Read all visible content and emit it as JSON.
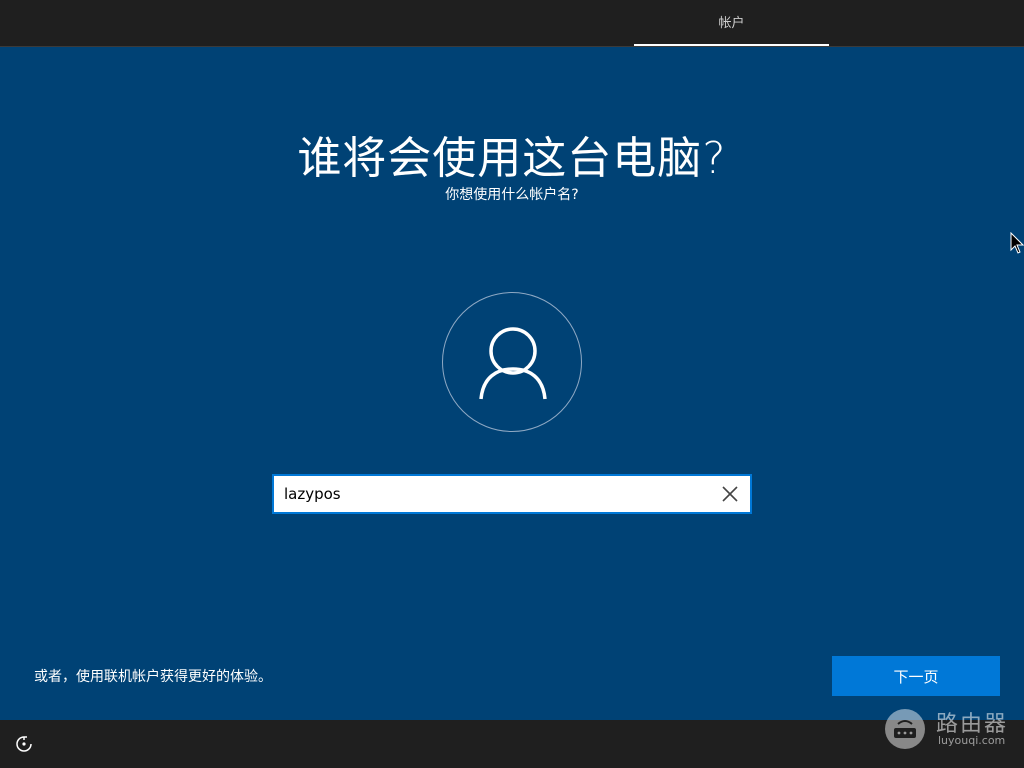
{
  "topbar": {
    "tab_label": "帐户"
  },
  "main": {
    "title": "谁将会使用这台电脑?",
    "subtitle": "你想使用什么帐户名?",
    "avatar_icon": "user-icon"
  },
  "name_input": {
    "value": "lazypos",
    "clear_icon": "close-icon"
  },
  "footer": {
    "alt_option_text": "或者，使用联机帐户获得更好的体验。",
    "next_label": "下一页"
  },
  "bottombar": {
    "ease_icon": "ease-of-access-icon"
  },
  "watermark": {
    "title": "路由器",
    "subtitle": "luyouqi.com"
  },
  "colors": {
    "background": "#004275",
    "bar": "#1f1f1f",
    "accent": "#0078d7"
  }
}
